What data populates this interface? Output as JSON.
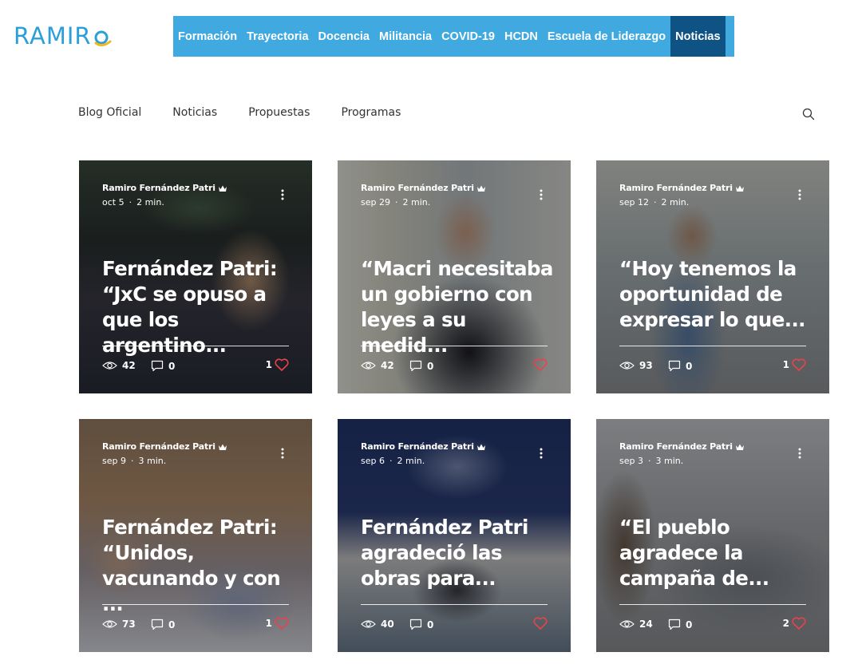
{
  "logo": {
    "text": "RAMIR",
    "last_letter": "O"
  },
  "topnav": {
    "items": [
      {
        "label": "Formación"
      },
      {
        "label": "Trayectoria"
      },
      {
        "label": "Docencia"
      },
      {
        "label": "Militancia"
      },
      {
        "label": "COVID-19"
      },
      {
        "label": "HCDN"
      },
      {
        "label": "Escuela de Liderazgo"
      },
      {
        "label": "Noticias",
        "active": true
      }
    ]
  },
  "blognav": {
    "items": [
      {
        "label": "Blog Oficial"
      },
      {
        "label": "Noticias"
      },
      {
        "label": "Propuestas"
      },
      {
        "label": "Programas"
      }
    ],
    "search_icon": "search-icon"
  },
  "colors": {
    "nav_bg": "#3fa9e0",
    "nav_active": "#0f5384",
    "logo": "#2a9fd8",
    "heart": "#e8434b"
  },
  "posts": [
    {
      "author": "Ramiro Fernández Patri",
      "date": "oct 5",
      "read": "2 min.",
      "title": "Fernández Patri: “JxC se opuso a que los argentino...",
      "views": "42",
      "comments": "0",
      "likes": "1"
    },
    {
      "author": "Ramiro Fernández Patri",
      "date": "sep 29",
      "read": "2 min.",
      "title": "“Macri necesitaba un gobierno con leyes a su medid...",
      "views": "42",
      "comments": "0",
      "likes": ""
    },
    {
      "author": "Ramiro Fernández Patri",
      "date": "sep 12",
      "read": "2 min.",
      "title": "“Hoy tenemos la oportunidad de expresar lo que...",
      "views": "93",
      "comments": "0",
      "likes": "1"
    },
    {
      "author": "Ramiro Fernández Patri",
      "date": "sep 9",
      "read": "3 min.",
      "title": "Fernández Patri: “Unidos, vacunando y con ...",
      "views": "73",
      "comments": "0",
      "likes": "1"
    },
    {
      "author": "Ramiro Fernández Patri",
      "date": "sep 6",
      "read": "2 min.",
      "title": "Fernández Patri agradeció las obras para...",
      "views": "40",
      "comments": "0",
      "likes": ""
    },
    {
      "author": "Ramiro Fernández Patri",
      "date": "sep 3",
      "read": "3 min.",
      "title": "“El pueblo agradece la campaña de...",
      "views": "24",
      "comments": "0",
      "likes": "2"
    }
  ]
}
